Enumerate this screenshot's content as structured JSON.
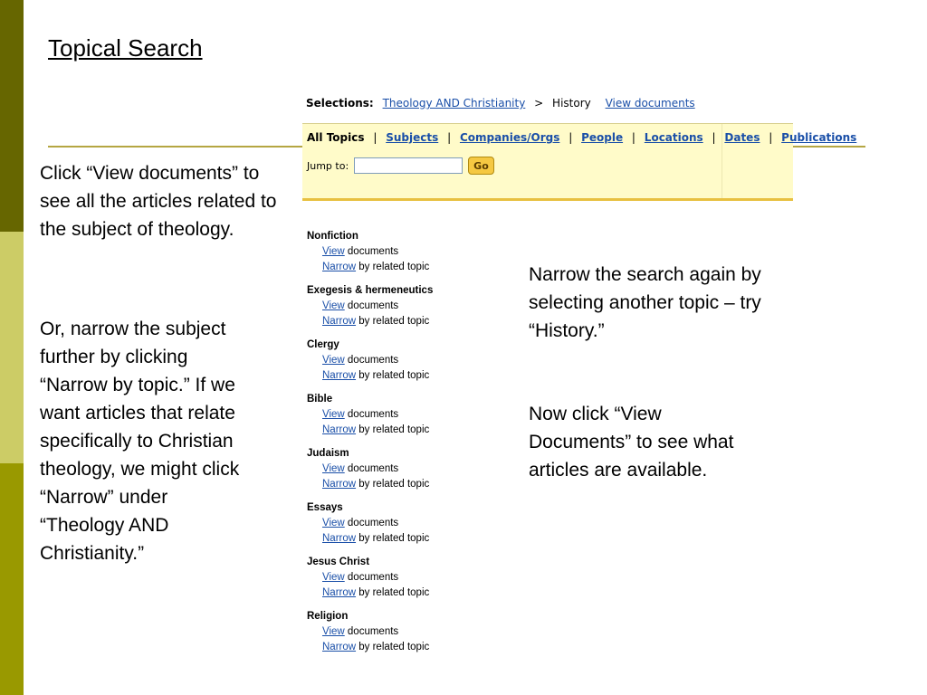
{
  "slide": {
    "title": "Topical Search",
    "note_left_1": "Click “View documents” to see all the articles related to the subject of theology.",
    "note_left_2": "Or, narrow the subject further by clicking “Narrow by topic.” If we want articles that relate specifically to Christian theology, we might click “Narrow” under “Theology AND Christianity.”",
    "note_right_1": "Narrow the search again by selecting another topic – try “History.”",
    "note_right_2": "Now click “View Documents” to see what articles are available."
  },
  "colors": {
    "strip_top": "#666600",
    "strip_mid": "#cccc66",
    "strip_bot": "#999900",
    "link": "#1a4fa8",
    "panel_bg": "#fffbc9"
  },
  "selections": {
    "label": "Selections:",
    "crumb_1": "Theology AND Christianity",
    "separator": ">",
    "current": "History",
    "view_link": "View documents"
  },
  "topics_bar": {
    "current_tab": "All Topics",
    "tabs": [
      "Subjects",
      "Companies/Orgs",
      "People",
      "Locations",
      "Dates",
      "Publications"
    ],
    "jump_label": "Jump to:",
    "jump_value": "",
    "go_label": "Go"
  },
  "topic_action_labels": {
    "view_link": "View",
    "view_suffix": " documents",
    "narrow_link": "Narrow",
    "narrow_suffix": " by related topic"
  },
  "topics": [
    "Nonfiction",
    "Exegesis & hermeneutics",
    "Clergy",
    "Bible",
    "Judaism",
    "Essays",
    "Jesus Christ",
    "Religion"
  ]
}
